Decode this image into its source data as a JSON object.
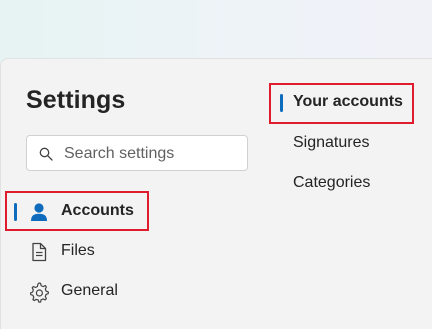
{
  "settings": {
    "title": "Settings",
    "search_placeholder": "Search settings",
    "nav": [
      {
        "label": "Accounts",
        "icon": "person-icon",
        "selected": true
      },
      {
        "label": "Files",
        "icon": "document-icon",
        "selected": false
      },
      {
        "label": "General",
        "icon": "gear-icon",
        "selected": false
      }
    ],
    "subnav": [
      {
        "label": "Your accounts",
        "selected": true
      },
      {
        "label": "Signatures",
        "selected": false
      },
      {
        "label": "Categories",
        "selected": false
      }
    ]
  },
  "colors": {
    "accent": "#0f6cbd",
    "highlight_box": "#e01b2d"
  }
}
